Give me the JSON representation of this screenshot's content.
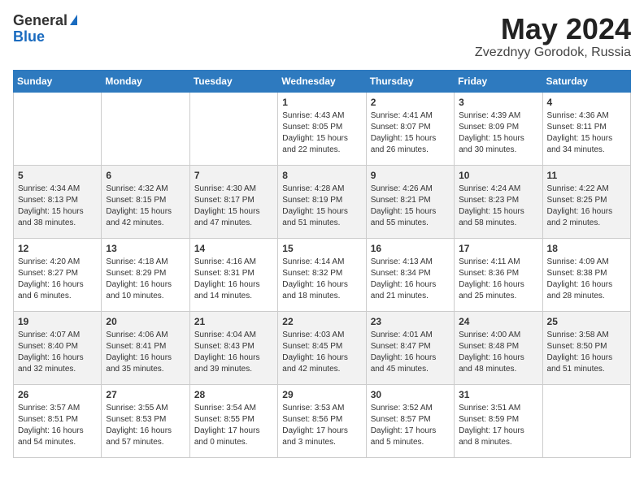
{
  "header": {
    "logo_general": "General",
    "logo_blue": "Blue",
    "title": "May 2024",
    "location": "Zvezdnyy Gorodok, Russia"
  },
  "weekdays": [
    "Sunday",
    "Monday",
    "Tuesday",
    "Wednesday",
    "Thursday",
    "Friday",
    "Saturday"
  ],
  "weeks": [
    [
      {
        "day": "",
        "info": ""
      },
      {
        "day": "",
        "info": ""
      },
      {
        "day": "",
        "info": ""
      },
      {
        "day": "1",
        "info": "Sunrise: 4:43 AM\nSunset: 8:05 PM\nDaylight: 15 hours\nand 22 minutes."
      },
      {
        "day": "2",
        "info": "Sunrise: 4:41 AM\nSunset: 8:07 PM\nDaylight: 15 hours\nand 26 minutes."
      },
      {
        "day": "3",
        "info": "Sunrise: 4:39 AM\nSunset: 8:09 PM\nDaylight: 15 hours\nand 30 minutes."
      },
      {
        "day": "4",
        "info": "Sunrise: 4:36 AM\nSunset: 8:11 PM\nDaylight: 15 hours\nand 34 minutes."
      }
    ],
    [
      {
        "day": "5",
        "info": "Sunrise: 4:34 AM\nSunset: 8:13 PM\nDaylight: 15 hours\nand 38 minutes."
      },
      {
        "day": "6",
        "info": "Sunrise: 4:32 AM\nSunset: 8:15 PM\nDaylight: 15 hours\nand 42 minutes."
      },
      {
        "day": "7",
        "info": "Sunrise: 4:30 AM\nSunset: 8:17 PM\nDaylight: 15 hours\nand 47 minutes."
      },
      {
        "day": "8",
        "info": "Sunrise: 4:28 AM\nSunset: 8:19 PM\nDaylight: 15 hours\nand 51 minutes."
      },
      {
        "day": "9",
        "info": "Sunrise: 4:26 AM\nSunset: 8:21 PM\nDaylight: 15 hours\nand 55 minutes."
      },
      {
        "day": "10",
        "info": "Sunrise: 4:24 AM\nSunset: 8:23 PM\nDaylight: 15 hours\nand 58 minutes."
      },
      {
        "day": "11",
        "info": "Sunrise: 4:22 AM\nSunset: 8:25 PM\nDaylight: 16 hours\nand 2 minutes."
      }
    ],
    [
      {
        "day": "12",
        "info": "Sunrise: 4:20 AM\nSunset: 8:27 PM\nDaylight: 16 hours\nand 6 minutes."
      },
      {
        "day": "13",
        "info": "Sunrise: 4:18 AM\nSunset: 8:29 PM\nDaylight: 16 hours\nand 10 minutes."
      },
      {
        "day": "14",
        "info": "Sunrise: 4:16 AM\nSunset: 8:31 PM\nDaylight: 16 hours\nand 14 minutes."
      },
      {
        "day": "15",
        "info": "Sunrise: 4:14 AM\nSunset: 8:32 PM\nDaylight: 16 hours\nand 18 minutes."
      },
      {
        "day": "16",
        "info": "Sunrise: 4:13 AM\nSunset: 8:34 PM\nDaylight: 16 hours\nand 21 minutes."
      },
      {
        "day": "17",
        "info": "Sunrise: 4:11 AM\nSunset: 8:36 PM\nDaylight: 16 hours\nand 25 minutes."
      },
      {
        "day": "18",
        "info": "Sunrise: 4:09 AM\nSunset: 8:38 PM\nDaylight: 16 hours\nand 28 minutes."
      }
    ],
    [
      {
        "day": "19",
        "info": "Sunrise: 4:07 AM\nSunset: 8:40 PM\nDaylight: 16 hours\nand 32 minutes."
      },
      {
        "day": "20",
        "info": "Sunrise: 4:06 AM\nSunset: 8:41 PM\nDaylight: 16 hours\nand 35 minutes."
      },
      {
        "day": "21",
        "info": "Sunrise: 4:04 AM\nSunset: 8:43 PM\nDaylight: 16 hours\nand 39 minutes."
      },
      {
        "day": "22",
        "info": "Sunrise: 4:03 AM\nSunset: 8:45 PM\nDaylight: 16 hours\nand 42 minutes."
      },
      {
        "day": "23",
        "info": "Sunrise: 4:01 AM\nSunset: 8:47 PM\nDaylight: 16 hours\nand 45 minutes."
      },
      {
        "day": "24",
        "info": "Sunrise: 4:00 AM\nSunset: 8:48 PM\nDaylight: 16 hours\nand 48 minutes."
      },
      {
        "day": "25",
        "info": "Sunrise: 3:58 AM\nSunset: 8:50 PM\nDaylight: 16 hours\nand 51 minutes."
      }
    ],
    [
      {
        "day": "26",
        "info": "Sunrise: 3:57 AM\nSunset: 8:51 PM\nDaylight: 16 hours\nand 54 minutes."
      },
      {
        "day": "27",
        "info": "Sunrise: 3:55 AM\nSunset: 8:53 PM\nDaylight: 16 hours\nand 57 minutes."
      },
      {
        "day": "28",
        "info": "Sunrise: 3:54 AM\nSunset: 8:55 PM\nDaylight: 17 hours\nand 0 minutes."
      },
      {
        "day": "29",
        "info": "Sunrise: 3:53 AM\nSunset: 8:56 PM\nDaylight: 17 hours\nand 3 minutes."
      },
      {
        "day": "30",
        "info": "Sunrise: 3:52 AM\nSunset: 8:57 PM\nDaylight: 17 hours\nand 5 minutes."
      },
      {
        "day": "31",
        "info": "Sunrise: 3:51 AM\nSunset: 8:59 PM\nDaylight: 17 hours\nand 8 minutes."
      },
      {
        "day": "",
        "info": ""
      }
    ]
  ]
}
